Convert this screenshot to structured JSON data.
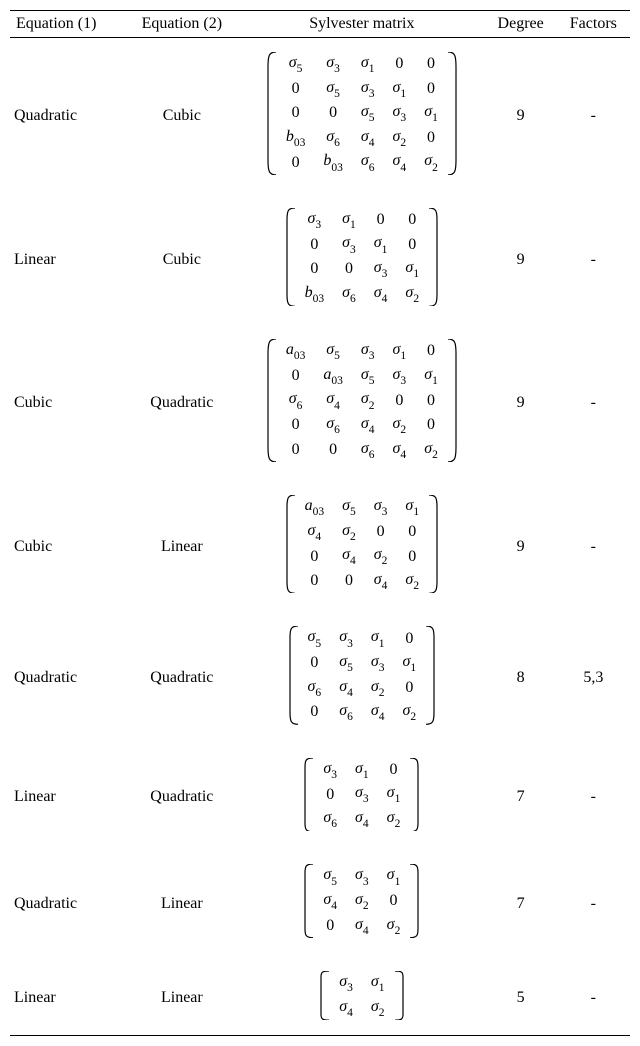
{
  "headers": {
    "eq1": "Equation (1)",
    "eq2": "Equation (2)",
    "sylv": "Sylvester matrix",
    "deg": "Degree",
    "fac": "Factors"
  },
  "rows": [
    {
      "eq1": "Quadratic",
      "eq2": "Cubic",
      "matrix": [
        [
          "σ_5",
          "σ_3",
          "σ_1",
          "0",
          "0"
        ],
        [
          "0",
          "σ_5",
          "σ_3",
          "σ_1",
          "0"
        ],
        [
          "0",
          "0",
          "σ_5",
          "σ_3",
          "σ_1"
        ],
        [
          "b_03",
          "σ_6",
          "σ_4",
          "σ_2",
          "0"
        ],
        [
          "0",
          "b_03",
          "σ_6",
          "σ_4",
          "σ_2"
        ]
      ],
      "degree": "9",
      "factors": "-"
    },
    {
      "eq1": "Linear",
      "eq2": "Cubic",
      "matrix": [
        [
          "σ_3",
          "σ_1",
          "0",
          "0"
        ],
        [
          "0",
          "σ_3",
          "σ_1",
          "0"
        ],
        [
          "0",
          "0",
          "σ_3",
          "σ_1"
        ],
        [
          "b_03",
          "σ_6",
          "σ_4",
          "σ_2"
        ]
      ],
      "degree": "9",
      "factors": "-"
    },
    {
      "eq1": "Cubic",
      "eq2": "Quadratic",
      "matrix": [
        [
          "a_03",
          "σ_5",
          "σ_3",
          "σ_1",
          "0"
        ],
        [
          "0",
          "a_03",
          "σ_5",
          "σ_3",
          "σ_1"
        ],
        [
          "σ_6",
          "σ_4",
          "σ_2",
          "0",
          "0"
        ],
        [
          "0",
          "σ_6",
          "σ_4",
          "σ_2",
          "0"
        ],
        [
          "0",
          "0",
          "σ_6",
          "σ_4",
          "σ_2"
        ]
      ],
      "degree": "9",
      "factors": "-"
    },
    {
      "eq1": "Cubic",
      "eq2": "Linear",
      "matrix": [
        [
          "a_03",
          "σ_5",
          "σ_3",
          "σ_1"
        ],
        [
          "σ_4",
          "σ_2",
          "0",
          "0"
        ],
        [
          "0",
          "σ_4",
          "σ_2",
          "0"
        ],
        [
          "0",
          "0",
          "σ_4",
          "σ_2"
        ]
      ],
      "degree": "9",
      "factors": "-"
    },
    {
      "eq1": "Quadratic",
      "eq2": "Quadratic",
      "matrix": [
        [
          "σ_5",
          "σ_3",
          "σ_1",
          "0"
        ],
        [
          "0",
          "σ_5",
          "σ_3",
          "σ_1"
        ],
        [
          "σ_6",
          "σ_4",
          "σ_2",
          "0"
        ],
        [
          "0",
          "σ_6",
          "σ_4",
          "σ_2"
        ]
      ],
      "degree": "8",
      "factors": "5,3"
    },
    {
      "eq1": "Linear",
      "eq2": "Quadratic",
      "matrix": [
        [
          "σ_3",
          "σ_1",
          "0"
        ],
        [
          "0",
          "σ_3",
          "σ_1"
        ],
        [
          "σ_6",
          "σ_4",
          "σ_2"
        ]
      ],
      "degree": "7",
      "factors": "-"
    },
    {
      "eq1": "Quadratic",
      "eq2": "Linear",
      "matrix": [
        [
          "σ_5",
          "σ_3",
          "σ_1"
        ],
        [
          "σ_4",
          "σ_2",
          "0"
        ],
        [
          "0",
          "σ_4",
          "σ_2"
        ]
      ],
      "degree": "7",
      "factors": "-"
    },
    {
      "eq1": "Linear",
      "eq2": "Linear",
      "matrix": [
        [
          "σ_3",
          "σ_1"
        ],
        [
          "σ_4",
          "σ_2"
        ]
      ],
      "degree": "5",
      "factors": "-"
    }
  ]
}
